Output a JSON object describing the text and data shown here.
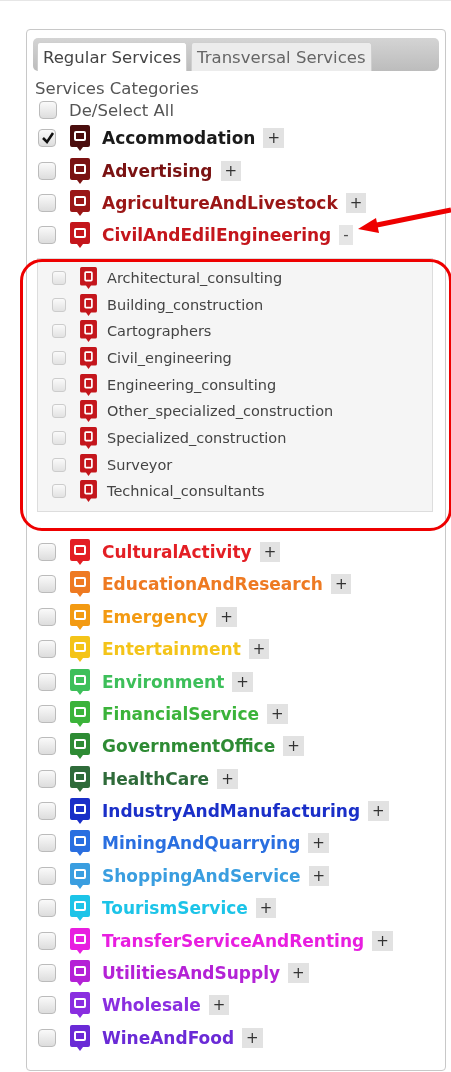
{
  "tabs": [
    {
      "label": "Regular Services",
      "selected": true
    },
    {
      "label": "Transversal Services",
      "selected": false
    }
  ],
  "heading": "Services Categories",
  "select_all": {
    "label": "De/Select All",
    "checked": false
  },
  "categories": [
    {
      "name": "Accommodation",
      "color": "#4a0d0d",
      "checked": true,
      "expanded": false,
      "toggle": "+"
    },
    {
      "name": "Advertising",
      "color": "#7a1212",
      "checked": false,
      "expanded": false,
      "toggle": "+"
    },
    {
      "name": "AgricultureAndLivestock",
      "color": "#9a1616",
      "checked": false,
      "expanded": false,
      "toggle": "+"
    },
    {
      "name": "CivilAndEdilEngineering",
      "color": "#c4161c",
      "checked": false,
      "expanded": true,
      "toggle": "-",
      "children": [
        {
          "name": "Architectural_consulting",
          "checked": false
        },
        {
          "name": "Building_construction",
          "checked": false
        },
        {
          "name": "Cartographers",
          "checked": false
        },
        {
          "name": "Civil_engineering",
          "checked": false
        },
        {
          "name": "Engineering_consulting",
          "checked": false
        },
        {
          "name": "Other_specialized_construction",
          "checked": false
        },
        {
          "name": "Specialized_construction",
          "checked": false
        },
        {
          "name": "Surveyor",
          "checked": false
        },
        {
          "name": "Technical_consultants",
          "checked": false
        }
      ]
    },
    {
      "name": "CulturalActivity",
      "color": "#e31e24",
      "checked": false,
      "expanded": false,
      "toggle": "+"
    },
    {
      "name": "EducationAndResearch",
      "color": "#ee7a22",
      "checked": false,
      "expanded": false,
      "toggle": "+"
    },
    {
      "name": "Emergency",
      "color": "#f39a12",
      "checked": false,
      "expanded": false,
      "toggle": "+"
    },
    {
      "name": "Entertainment",
      "color": "#f4c419",
      "checked": false,
      "expanded": false,
      "toggle": "+"
    },
    {
      "name": "Environment",
      "color": "#3dbf5a",
      "checked": false,
      "expanded": false,
      "toggle": "+"
    },
    {
      "name": "FinancialService",
      "color": "#3bb33a",
      "checked": false,
      "expanded": false,
      "toggle": "+"
    },
    {
      "name": "GovernmentOffice",
      "color": "#2e8b34",
      "checked": false,
      "expanded": false,
      "toggle": "+"
    },
    {
      "name": "HealthCare",
      "color": "#2f6b3a",
      "checked": false,
      "expanded": false,
      "toggle": "+"
    },
    {
      "name": "IndustryAndManufacturing",
      "color": "#1a2fc8",
      "checked": false,
      "expanded": false,
      "toggle": "+"
    },
    {
      "name": "MiningAndQuarrying",
      "color": "#2a6fe0",
      "checked": false,
      "expanded": false,
      "toggle": "+"
    },
    {
      "name": "ShoppingAndService",
      "color": "#3a9ee0",
      "checked": false,
      "expanded": false,
      "toggle": "+"
    },
    {
      "name": "TourismService",
      "color": "#1cc4e8",
      "checked": false,
      "expanded": false,
      "toggle": "+"
    },
    {
      "name": "TransferServiceAndRenting",
      "color": "#e81ee0",
      "checked": false,
      "expanded": false,
      "toggle": "+"
    },
    {
      "name": "UtilitiesAndSupply",
      "color": "#b422d6",
      "checked": false,
      "expanded": false,
      "toggle": "+"
    },
    {
      "name": "Wholesale",
      "color": "#8a2ee0",
      "checked": false,
      "expanded": false,
      "toggle": "+"
    },
    {
      "name": "WineAndFood",
      "color": "#6a2ad6",
      "checked": false,
      "expanded": false,
      "toggle": "+"
    }
  ]
}
